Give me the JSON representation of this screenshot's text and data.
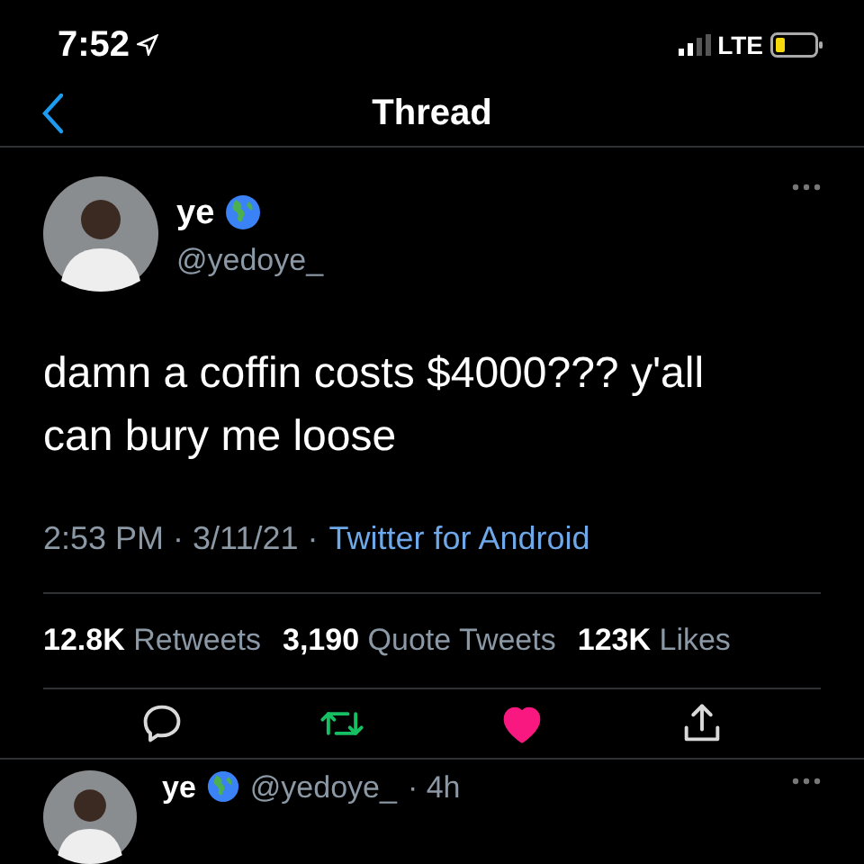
{
  "status_bar": {
    "time": "7:52",
    "network": "LTE"
  },
  "nav": {
    "title": "Thread"
  },
  "tweet": {
    "name": "ye",
    "handle": "@yedoye_",
    "text": "damn a coffin costs $4000??? y'all can bury me loose",
    "meta": "2:53 PM · 3/11/21 ·",
    "source": "Twitter for Android",
    "stats": [
      {
        "count": "12.8K",
        "label": "Retweets"
      },
      {
        "count": "3,190",
        "label": "Quote Tweets"
      },
      {
        "count": "123K",
        "label": "Likes"
      }
    ],
    "actions": [
      {
        "kind": "reply",
        "active": false
      },
      {
        "kind": "retweet",
        "active": true
      },
      {
        "kind": "like",
        "active": true
      },
      {
        "kind": "share",
        "active": false
      }
    ]
  },
  "reply": {
    "name": "ye",
    "handle": "@yedoye_",
    "age": "· 4h"
  }
}
